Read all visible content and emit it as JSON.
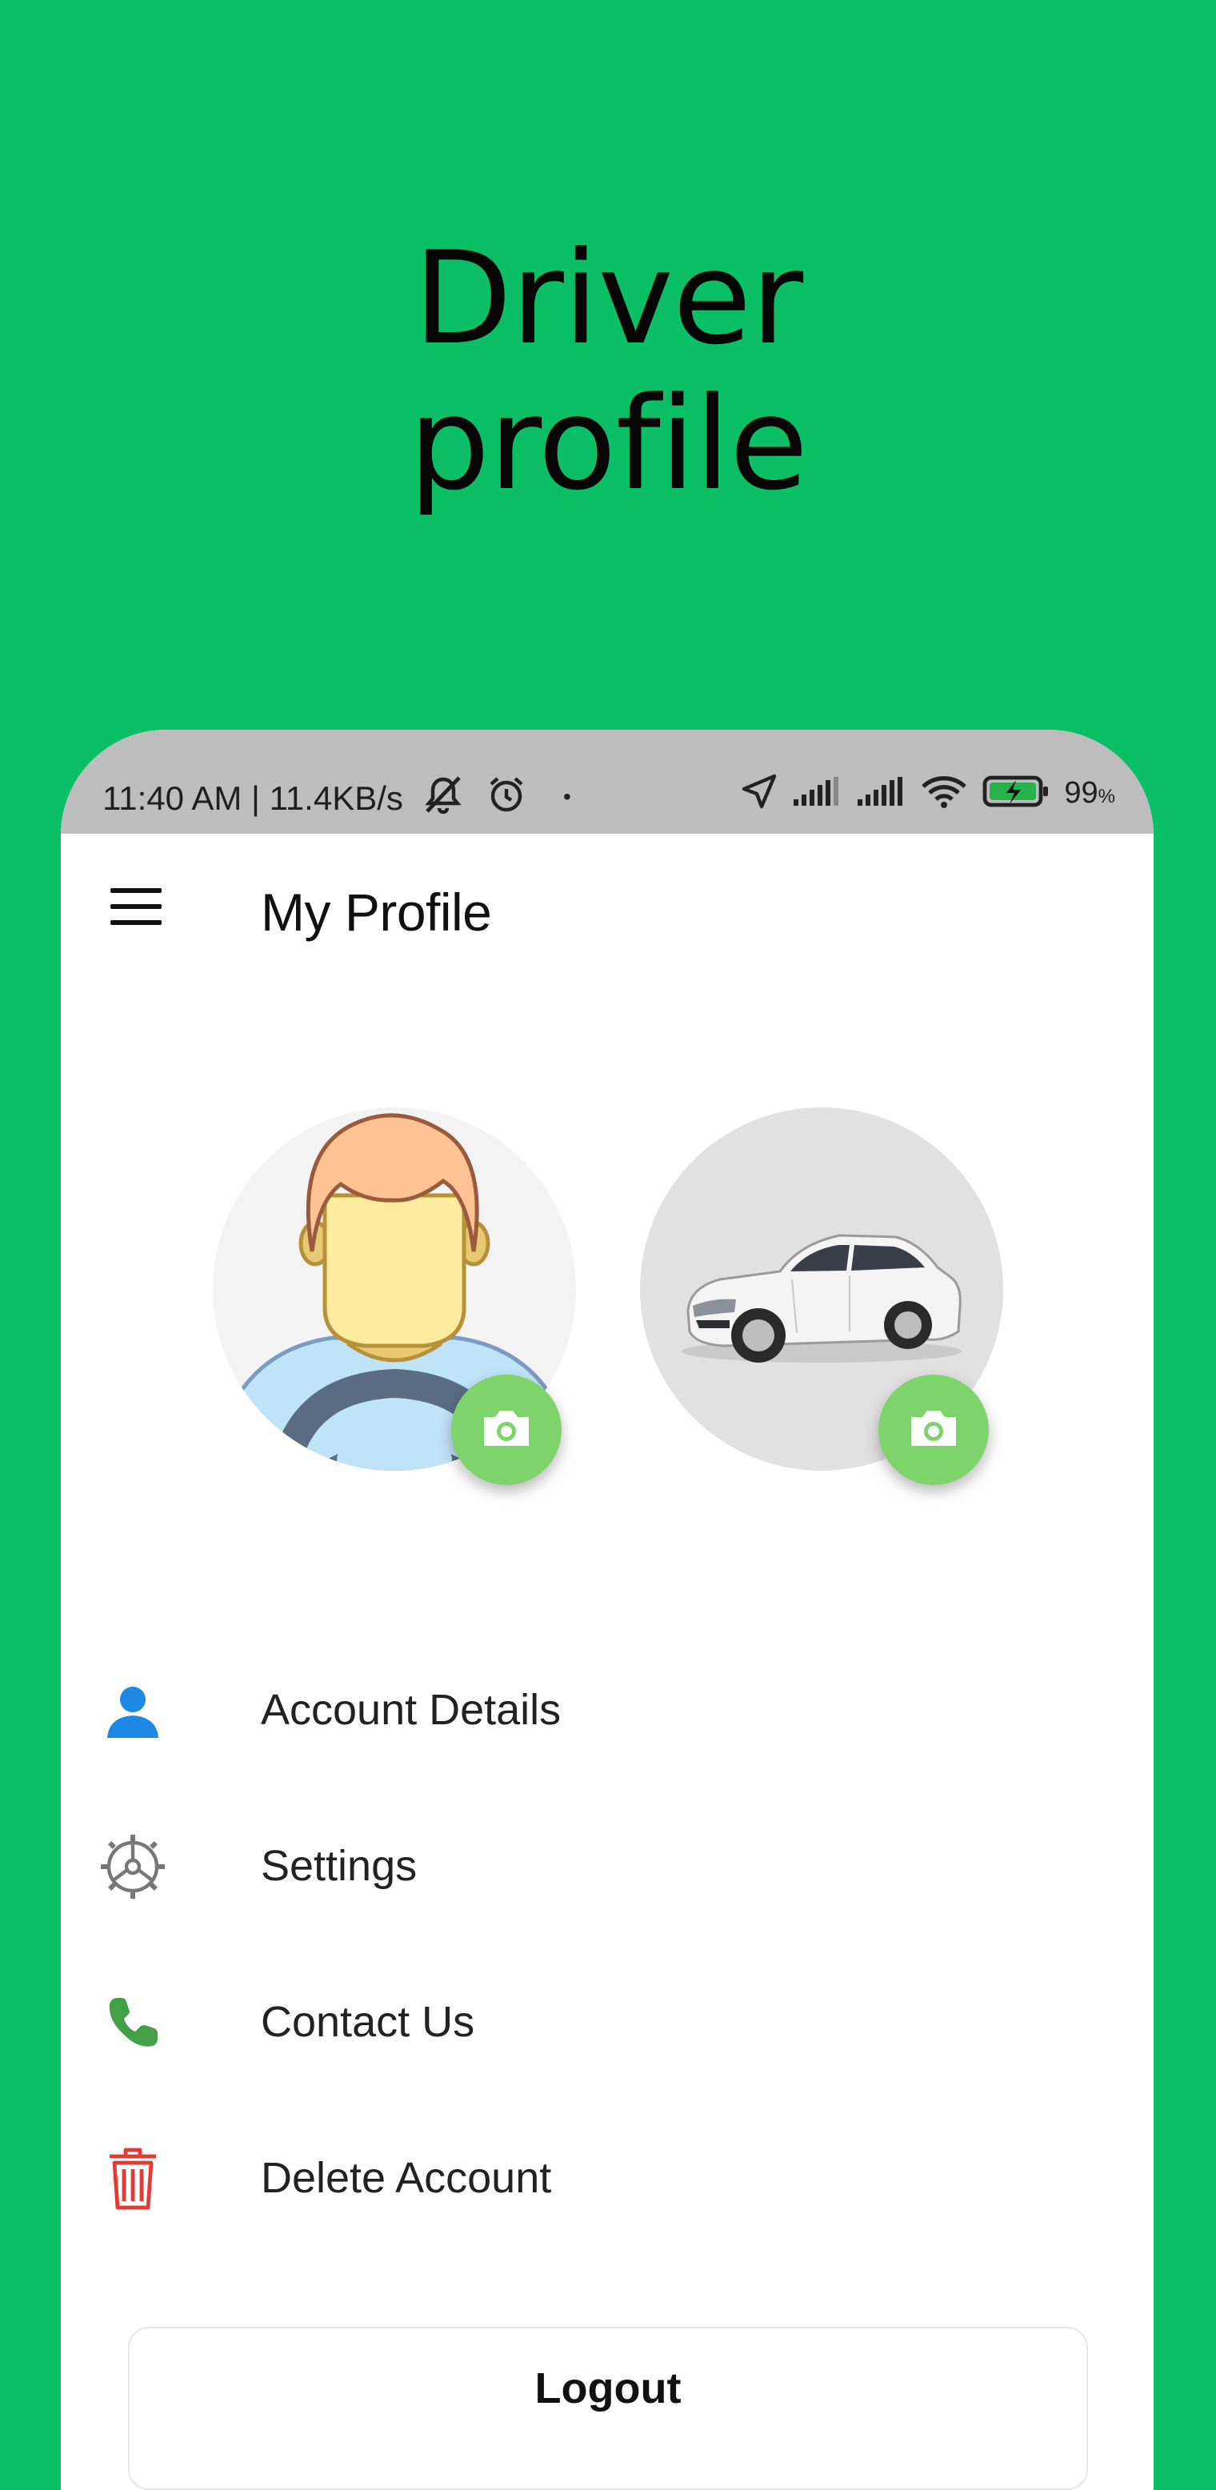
{
  "hero": {
    "line1": "Driver",
    "line2": "profile"
  },
  "status_bar": {
    "text": "11:40 AM | 11.4KB/s",
    "dot": "•",
    "battery_percent": "99",
    "battery_unit": "%"
  },
  "app_bar": {
    "title": "My Profile",
    "menu_icon": "hamburger-menu-icon"
  },
  "profile": {
    "driver_avatar_icon": "driver-avatar",
    "vehicle_photo_icon": "sedan-car",
    "camera_icon": "camera-icon"
  },
  "menu": {
    "items": [
      {
        "label": "Account Details",
        "icon": "person-icon",
        "color": "#1e88e5"
      },
      {
        "label": "Settings",
        "icon": "gear-icon",
        "color": "#777777"
      },
      {
        "label": "Contact Us",
        "icon": "phone-icon",
        "color": "#43a047"
      },
      {
        "label": "Delete Account",
        "icon": "trash-icon",
        "color": "#e53935"
      }
    ]
  },
  "logout": {
    "label": "Logout"
  },
  "colors": {
    "background": "#0bbf67",
    "status_bar": "#bdbdbd",
    "camera_button": "#7ed36a"
  }
}
